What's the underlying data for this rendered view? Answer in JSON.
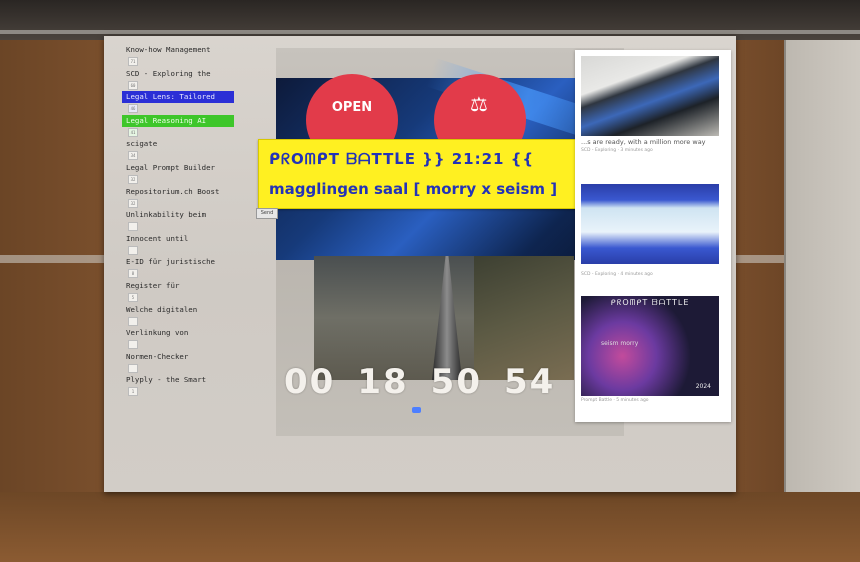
{
  "sidebar": {
    "items": [
      {
        "label": "Know-how Management",
        "count": "71",
        "state": "normal"
      },
      {
        "label": "SCD - Exploring the",
        "count": "60",
        "state": "normal"
      },
      {
        "label": "Legal Lens: Tailored",
        "count": "46",
        "state": "blue"
      },
      {
        "label": "Legal Reasoning AI",
        "count": "41",
        "state": "green"
      },
      {
        "label": "scigate",
        "count": "34",
        "state": "normal"
      },
      {
        "label": "Legal Prompt Builder",
        "count": "32",
        "state": "normal"
      },
      {
        "label": "Repositorium.ch Boost",
        "count": "32",
        "state": "normal"
      },
      {
        "label": "Unlinkability beim",
        "count": "",
        "state": "normal"
      },
      {
        "label": "Innocent until",
        "count": "",
        "state": "normal"
      },
      {
        "label": "E-ID für juristische",
        "count": "8",
        "state": "normal"
      },
      {
        "label": "Register für",
        "count": "5",
        "state": "normal"
      },
      {
        "label": "Welche digitalen",
        "count": "",
        "state": "normal"
      },
      {
        "label": "Verlinkung von",
        "count": "",
        "state": "normal"
      },
      {
        "label": "Normen-Checker",
        "count": "",
        "state": "normal"
      },
      {
        "label": "Plyply - the Smart",
        "count": "1",
        "state": "normal"
      }
    ]
  },
  "chat": {
    "line1": "ᑭᖇOᗰᑭT ᗷᗩTTᒪE }} 21:21 {{",
    "line2": "magglingen saal [ morry x seism ]",
    "send_label": "Send"
  },
  "hero": {
    "sign_text": "OPEN"
  },
  "timer": {
    "digits": [
      "00",
      "18",
      "50",
      "54"
    ]
  },
  "feed": {
    "cards": [
      {
        "text": "...s are ready, with a million more way",
        "meta": "SCD - Exploring · 3 minutes ago"
      },
      {
        "text": "",
        "meta": "SCD - Exploring · 4 minutes ago"
      },
      {
        "text": "",
        "meta": "Prompt Battle · 5 minutes ago"
      }
    ],
    "poster": {
      "title": "ᑭᖇOᗰᑭT ᗷᗩTTᒪE",
      "names": "seism   morry",
      "year": "2024"
    }
  },
  "colors": {
    "chat_bg": "#fff021",
    "chat_text": "#2333b8",
    "active_blue": "#2b2fd6",
    "active_green": "#3ec62a",
    "sign_red": "#e23b4a"
  }
}
